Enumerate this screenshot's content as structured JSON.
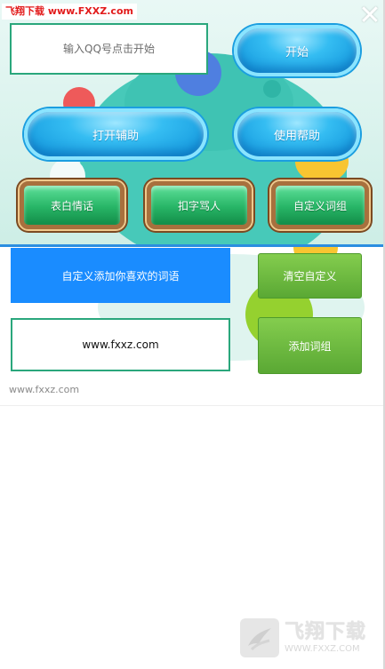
{
  "watermark_top": "飞翔下载 www.FXXZ.com",
  "close_label": "✕",
  "qq_input": {
    "value": "",
    "placeholder": "输入QQ号点击开始"
  },
  "buttons": {
    "start": "开始",
    "open_assist": "打开辅助",
    "help": "使用帮助",
    "confess": "表白情话",
    "typing_curse": "扣字骂人",
    "custom_phrases": "自定义词组"
  },
  "custom_section": {
    "label": "自定义添加你喜欢的词语",
    "clear_button": "清空自定义",
    "word_input_value": "www.fxxz.com",
    "add_group_button": "添加词组"
  },
  "footer_url": "www.fxxz.com",
  "logo": {
    "cn": "飞翔下载",
    "en": "WWW.FXXZ.COM"
  },
  "colors": {
    "accent_blue": "#1a8cff",
    "button_green": "#5aa834",
    "teal": "#47c9b9",
    "watermark_red": "#e21b1b"
  },
  "icons": {
    "close": "close-icon",
    "logo": "fxxz-logo-icon"
  }
}
